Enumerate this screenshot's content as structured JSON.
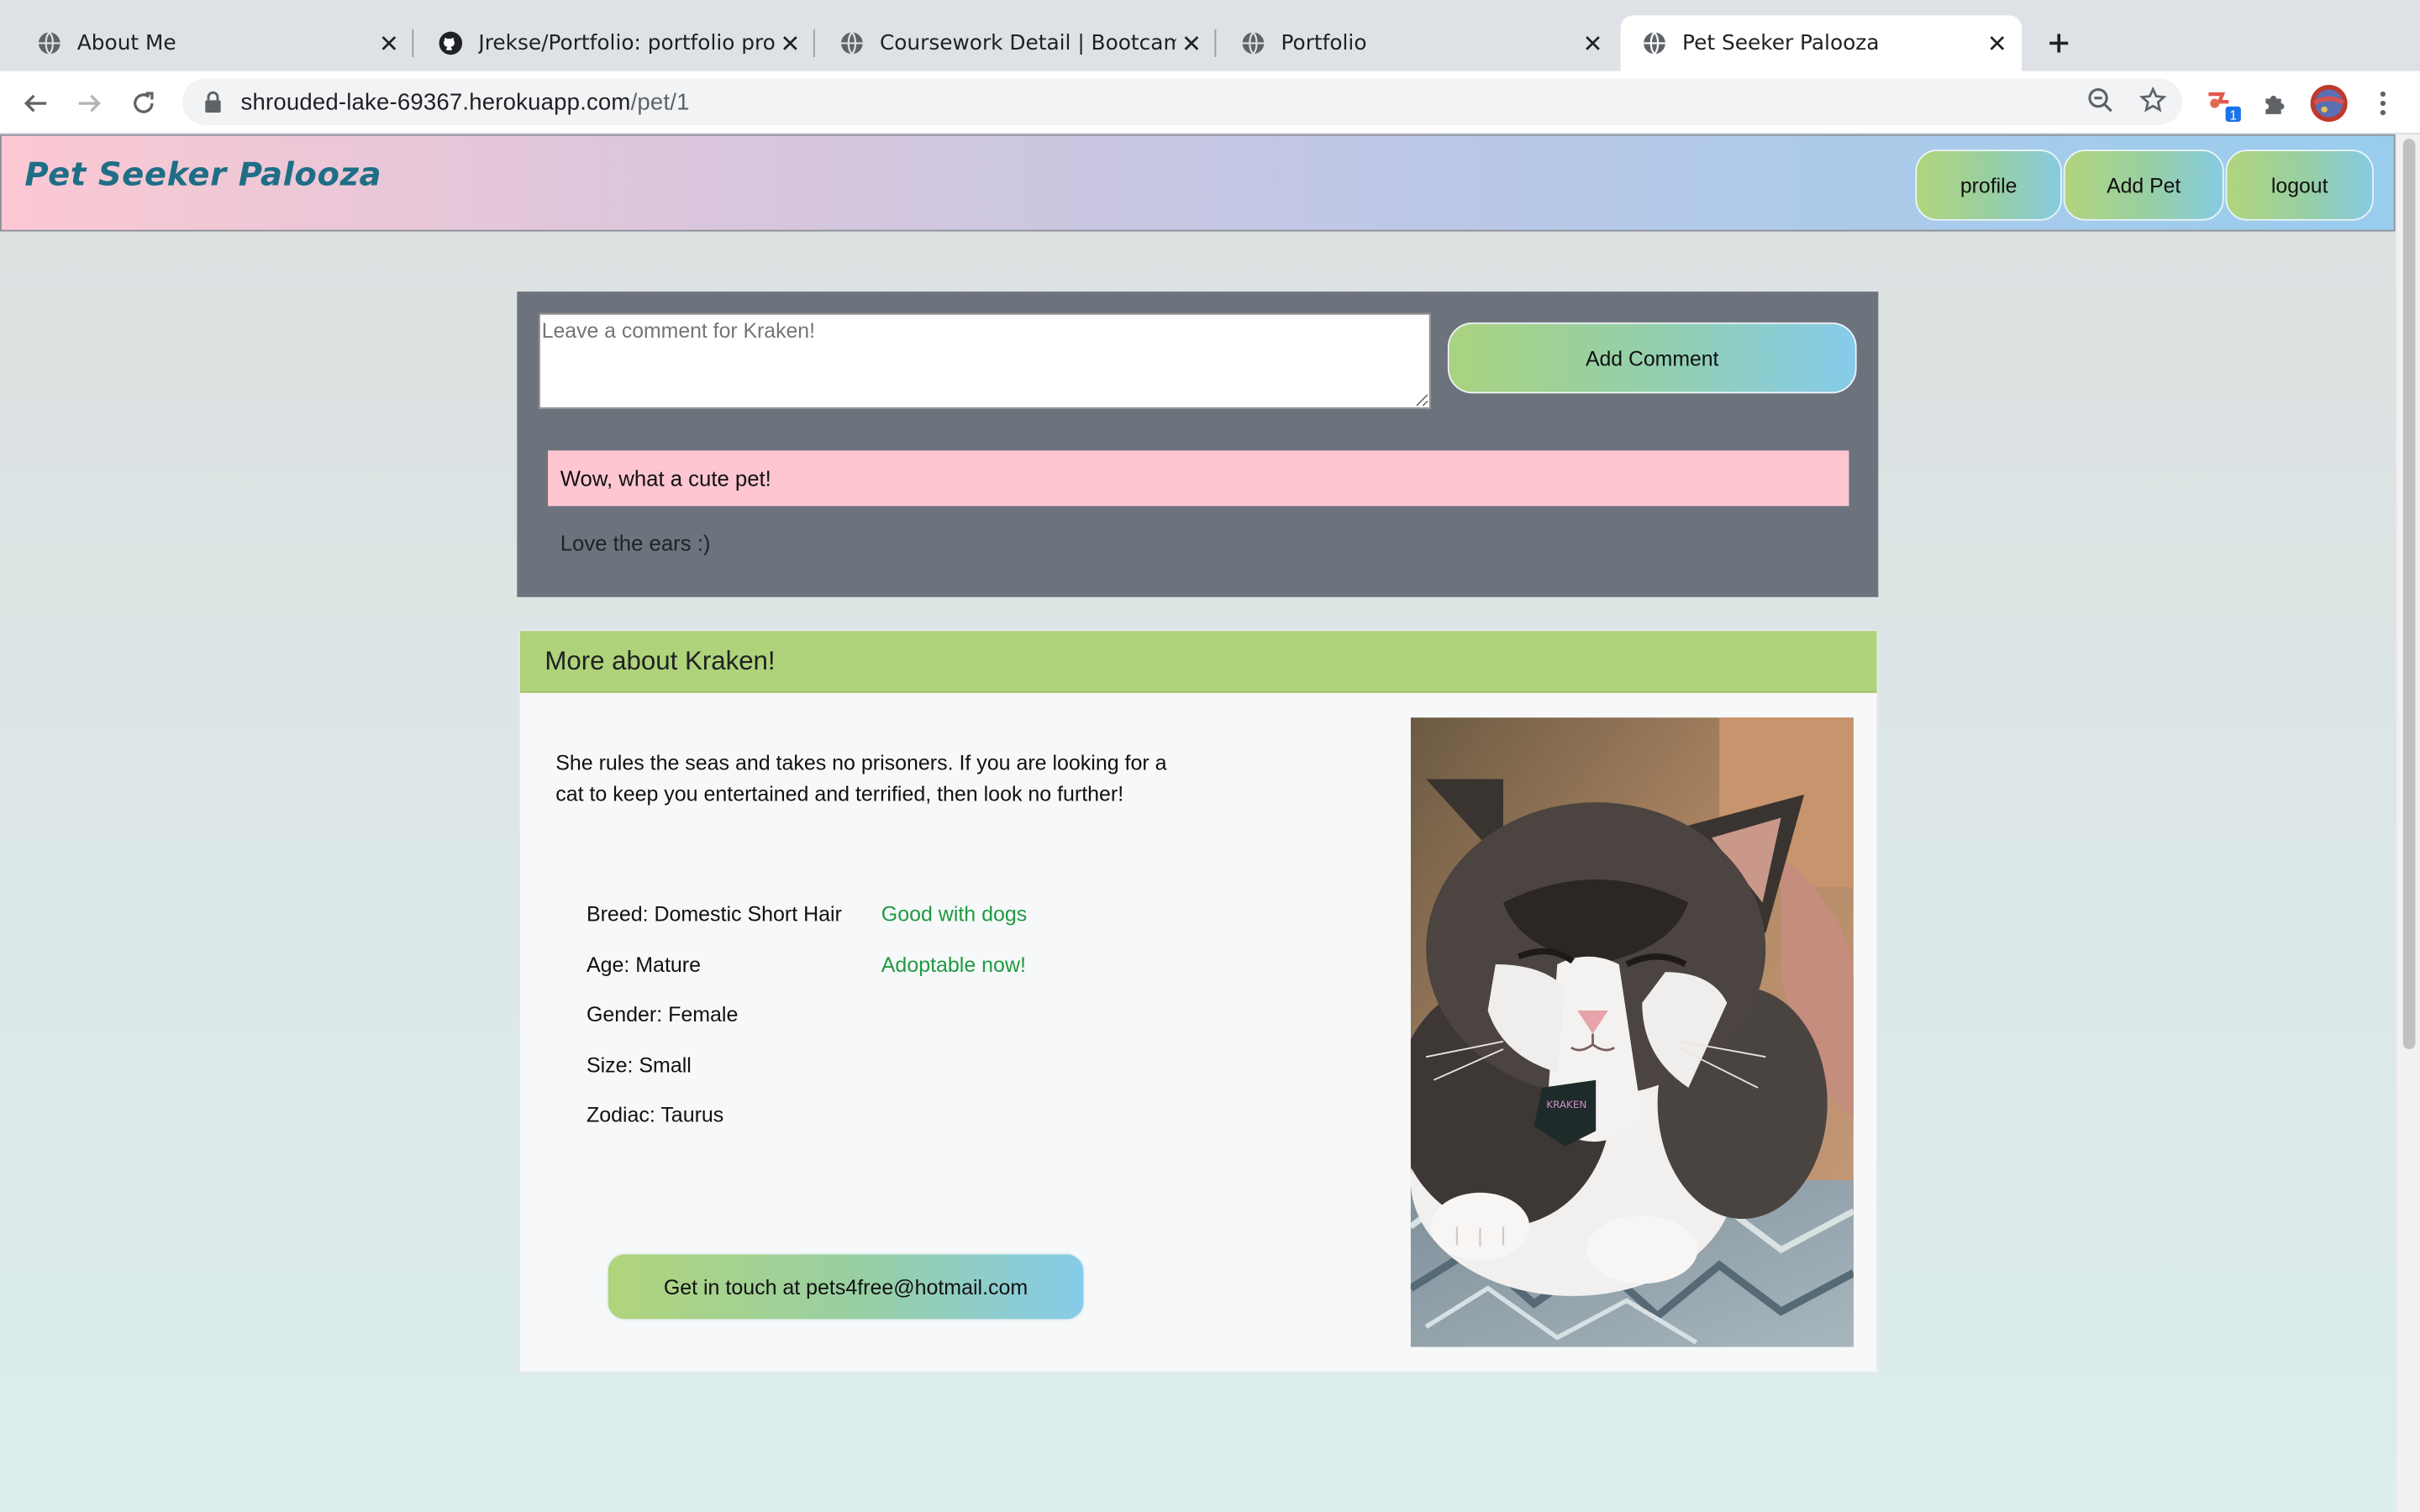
{
  "browser": {
    "tabs": [
      {
        "title": "About Me",
        "icon": "globe-icon"
      },
      {
        "title": "Jrekse/Portfolio: portfolio proje",
        "icon": "github-icon"
      },
      {
        "title": "Coursework Detail | Bootcamp",
        "icon": "globe-icon"
      },
      {
        "title": "Portfolio",
        "icon": "globe-icon"
      },
      {
        "title": "Pet Seeker Palooza",
        "icon": "globe-icon",
        "active": true
      }
    ],
    "url_host": "shrouded-lake-69367.herokuapp.com",
    "url_path": "/pet/1",
    "extension_badge": "1"
  },
  "site": {
    "brand": "Pet Seeker Palooza",
    "nav": [
      "profile",
      "Add Pet",
      "logout"
    ]
  },
  "comments": {
    "placeholder": "Leave a comment for Kraken!",
    "submit_label": "Add Comment",
    "items": [
      "Wow, what a cute pet!",
      "Love the ears :)"
    ]
  },
  "pet": {
    "header": "More about Kraken!",
    "description": "She rules the seas and takes no prisoners. If you are looking for a cat to keep you entertained and terrified, then look no further!",
    "attributes": [
      "Breed: Domestic Short Hair",
      "Age: Mature",
      "Gender: Female",
      "Size: Small",
      "Zodiac: Taurus"
    ],
    "flags": [
      "Good with dogs",
      "Adoptable now!"
    ],
    "contact_label": "Get in touch at pets4free@hotmail.com",
    "tag_text": "KRAKEN"
  },
  "colors": {
    "nav_gradient": [
      "#fcc8d3",
      "#98cdee"
    ],
    "button_gradient": [
      "#b0d47d",
      "#86cbe3"
    ],
    "card_header": "#aed37a",
    "comments_panel": "#6c737d",
    "highlight_comment": "#fec6d1",
    "flag_text": "#219a41",
    "brand_text": "#1e6e86"
  }
}
